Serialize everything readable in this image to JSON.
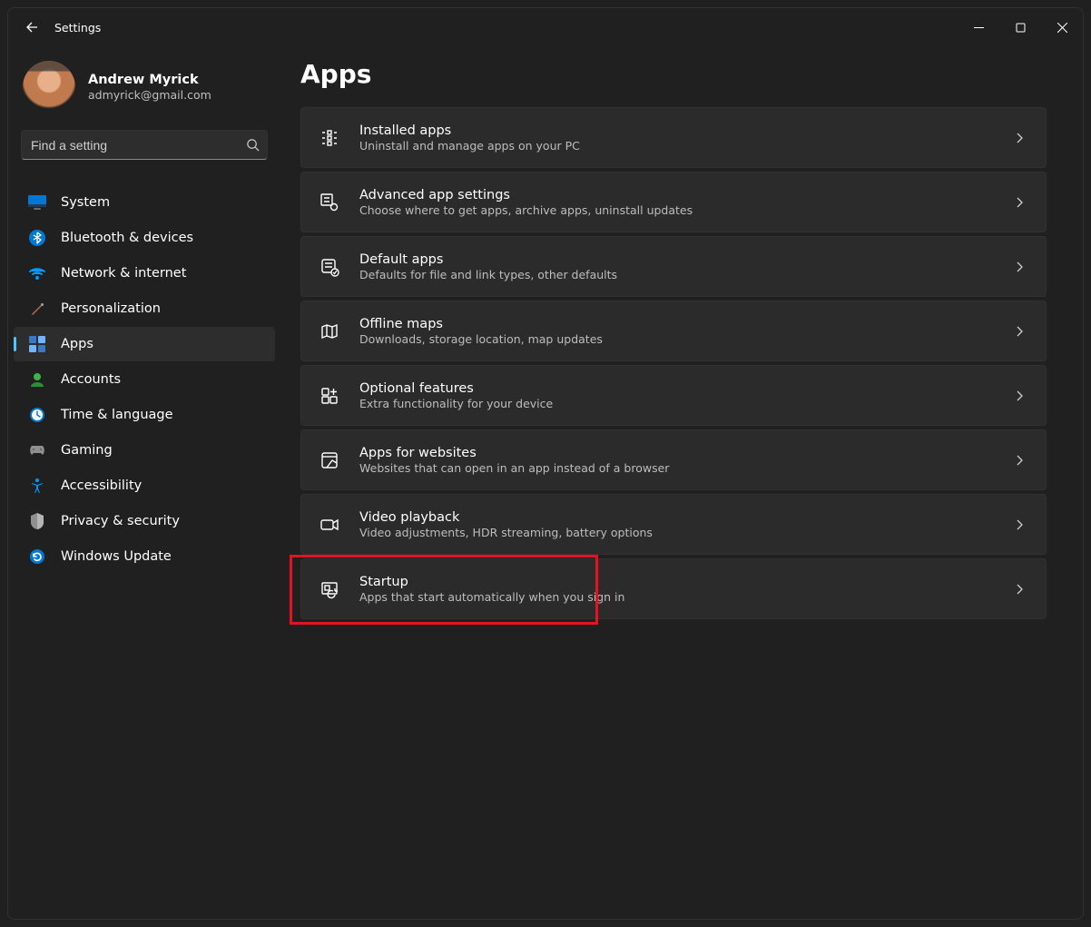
{
  "window": {
    "title": "Settings"
  },
  "profile": {
    "name": "Andrew Myrick",
    "email": "admyrick@gmail.com"
  },
  "search": {
    "placeholder": "Find a setting"
  },
  "sidebar": {
    "items": [
      {
        "label": "System"
      },
      {
        "label": "Bluetooth & devices"
      },
      {
        "label": "Network & internet"
      },
      {
        "label": "Personalization"
      },
      {
        "label": "Apps"
      },
      {
        "label": "Accounts"
      },
      {
        "label": "Time & language"
      },
      {
        "label": "Gaming"
      },
      {
        "label": "Accessibility"
      },
      {
        "label": "Privacy & security"
      },
      {
        "label": "Windows Update"
      }
    ]
  },
  "page": {
    "title": "Apps"
  },
  "cards": [
    {
      "title": "Installed apps",
      "desc": "Uninstall and manage apps on your PC"
    },
    {
      "title": "Advanced app settings",
      "desc": "Choose where to get apps, archive apps, uninstall updates"
    },
    {
      "title": "Default apps",
      "desc": "Defaults for file and link types, other defaults"
    },
    {
      "title": "Offline maps",
      "desc": "Downloads, storage location, map updates"
    },
    {
      "title": "Optional features",
      "desc": "Extra functionality for your device"
    },
    {
      "title": "Apps for websites",
      "desc": "Websites that can open in an app instead of a browser"
    },
    {
      "title": "Video playback",
      "desc": "Video adjustments, HDR streaming, battery options"
    },
    {
      "title": "Startup",
      "desc": "Apps that start automatically when you sign in"
    }
  ]
}
